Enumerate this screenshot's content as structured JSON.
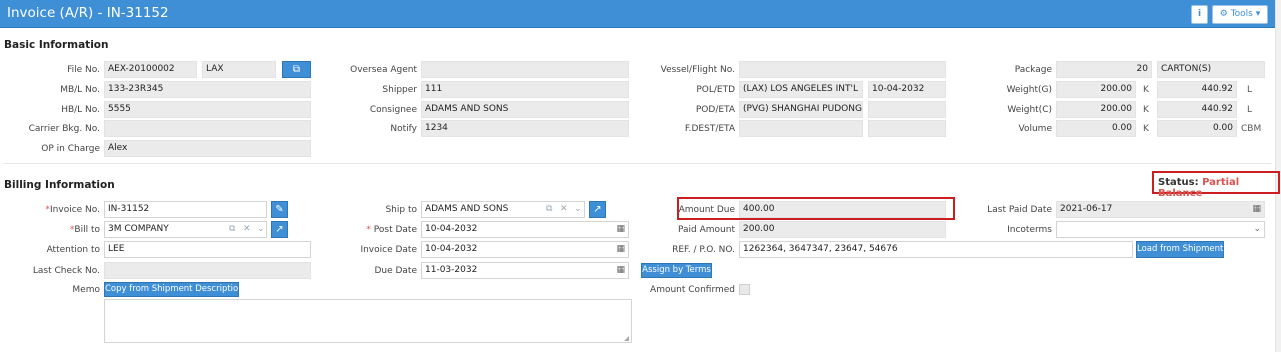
{
  "window": {
    "title": "Invoice (A/R) - IN-31152"
  },
  "toolbar": {
    "info_label": "i",
    "tools_label": "Tools"
  },
  "basic": {
    "title": "Basic Information",
    "file_no_label": "File No.",
    "file_no": "AEX-20100002",
    "file_branch": "LAX",
    "mbl_label": "MB/L No.",
    "mbl": "133-23R345",
    "hbl_label": "HB/L No.",
    "hbl": "5555",
    "carrier_bkg_label": "Carrier Bkg. No.",
    "carrier_bkg": "",
    "op_label": "OP in Charge",
    "op": "Alex",
    "oversea_agent_label": "Oversea Agent",
    "oversea_agent": "",
    "shipper_label": "Shipper",
    "shipper": "111",
    "consignee_label": "Consignee",
    "consignee": "ADAMS AND SONS",
    "notify_label": "Notify",
    "notify": "1234",
    "vessel_label": "Vessel/Flight No.",
    "vessel": "",
    "pol_label": "POL/ETD",
    "pol": "(LAX) LOS ANGELES INT'L",
    "etd": "10-04-2032",
    "pod_label": "POD/ETA",
    "pod": "(PVG) SHANGHAI PUDONG I",
    "eta": "",
    "fdest_label": "F.DEST/ETA",
    "fdest": "",
    "fdest_eta": "",
    "package_label": "Package",
    "package_qty": "20",
    "package_unit": "CARTON(S)",
    "weight_g_label": "Weight(G)",
    "weight_g_k": "200.00",
    "weight_g_l": "440.92",
    "weight_c_label": "Weight(C)",
    "weight_c_k": "200.00",
    "weight_c_l": "440.92",
    "volume_label": "Volume",
    "volume_k": "0.00",
    "volume_cbm": "0.00",
    "unit_k": "K",
    "unit_l": "L",
    "unit_cbm": "CBM"
  },
  "billing": {
    "title": "Billing Information",
    "status_label": "Status:",
    "status_value": "Partial Balance",
    "invoice_no_label": "Invoice No.",
    "invoice_no": "IN-31152",
    "bill_to_label": "Bill to",
    "bill_to": "3M COMPANY",
    "attention_label": "Attention to",
    "attention": "LEE",
    "last_check_label": "Last Check No.",
    "last_check": "",
    "memo_label": "Memo",
    "copy_btn": "Copy from Shipment Description",
    "ship_to_label": "Ship to",
    "ship_to": "ADAMS AND SONS",
    "post_date_label": "Post Date",
    "post_date": "10-04-2032",
    "invoice_date_label": "Invoice Date",
    "invoice_date": "10-04-2032",
    "due_date_label": "Due Date",
    "due_date": "11-03-2032",
    "assign_btn": "Assign by Terms",
    "amount_due_label": "Amount Due",
    "amount_due": "400.00",
    "paid_amount_label": "Paid Amount",
    "paid_amount": "200.00",
    "ref_label": "REF. / P.O. NO.",
    "ref": "1262364, 3647347, 23647, 54676",
    "amount_confirmed_label": "Amount Confirmed",
    "last_paid_label": "Last Paid Date",
    "last_paid": "2021-06-17",
    "incoterms_label": "Incoterms",
    "incoterms": "",
    "load_btn": "Load from Shipment"
  }
}
